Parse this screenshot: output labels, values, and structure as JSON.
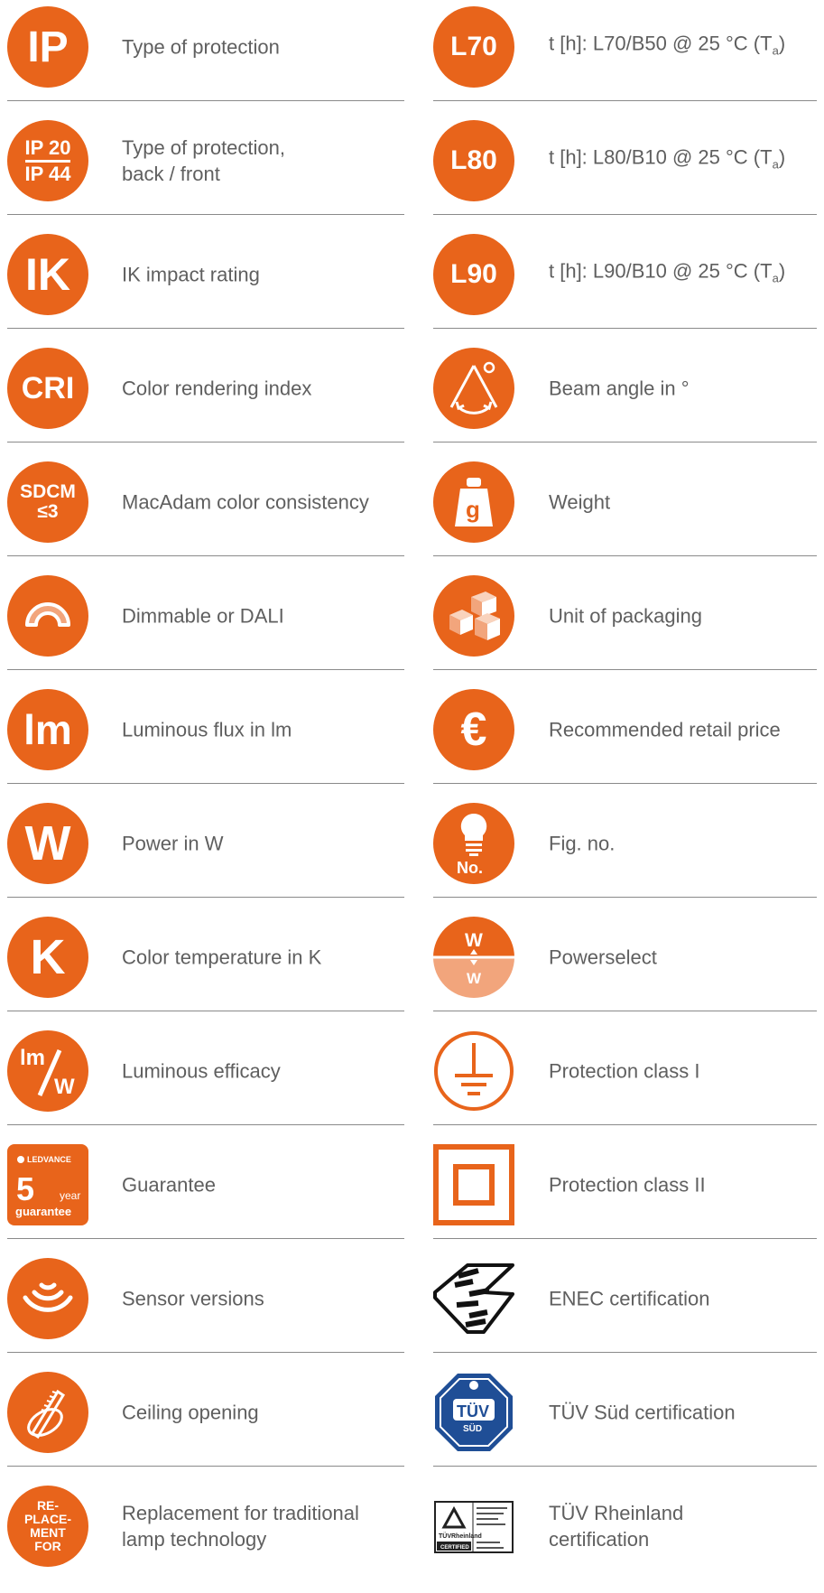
{
  "colors": {
    "accent": "#e8641b",
    "accent_light": "#f2a57c",
    "text": "#5f5f5f",
    "rule": "#8a8a8a"
  },
  "left": [
    {
      "icon": "ip-icon",
      "icon_text": "IP",
      "label": "Type of protection"
    },
    {
      "icon": "ip20-ip44-icon",
      "icon_text_top": "IP 20",
      "icon_text_bottom": "IP 44",
      "label": "Type of protection,\nback / front"
    },
    {
      "icon": "ik-icon",
      "icon_text": "IK",
      "label": "IK impact rating"
    },
    {
      "icon": "cri-icon",
      "icon_text": "CRI",
      "label": "Color rendering index"
    },
    {
      "icon": "sdcm-icon",
      "icon_text_top": "SDCM",
      "icon_text_bottom": "≤3",
      "label": "MacAdam color consistency"
    },
    {
      "icon": "dimmable-icon",
      "label": "Dimmable or DALI"
    },
    {
      "icon": "lm-icon",
      "icon_text": "lm",
      "label": "Luminous flux in lm"
    },
    {
      "icon": "watt-icon",
      "icon_text": "W",
      "label": "Power in W"
    },
    {
      "icon": "kelvin-icon",
      "icon_text": "K",
      "label": "Color temperature in K"
    },
    {
      "icon": "lm-per-w-icon",
      "icon_text_top": "lm",
      "icon_text_bottom": "W",
      "label": "Luminous efficacy"
    },
    {
      "icon": "guarantee-icon",
      "brand": "LEDVANCE",
      "number": "5",
      "unit": "year",
      "word": "guarantee",
      "label": "Guarantee"
    },
    {
      "icon": "sensor-icon",
      "label": "Sensor versions"
    },
    {
      "icon": "ceiling-opening-icon",
      "label": "Ceiling opening"
    },
    {
      "icon": "replacement-icon",
      "icon_lines": [
        "RE-",
        "PLACE-",
        "MENT",
        "FOR"
      ],
      "label": "Replacement for traditional\nlamp technology"
    }
  ],
  "right": [
    {
      "icon": "l70-icon",
      "icon_text": "L70",
      "label": "t [h]: L70/B50 @ 25 °C (T",
      "sub": "a",
      "close": ")"
    },
    {
      "icon": "l80-icon",
      "icon_text": "L80",
      "label": "t [h]: L80/B10 @ 25 °C (T",
      "sub": "a",
      "close": ")"
    },
    {
      "icon": "l90-icon",
      "icon_text": "L90",
      "label": "t [h]: L90/B10 @ 25 °C (T",
      "sub": "a",
      "close": ")"
    },
    {
      "icon": "beam-angle-icon",
      "label": "Beam angle in °"
    },
    {
      "icon": "weight-icon",
      "icon_text": "g",
      "label": "Weight"
    },
    {
      "icon": "packaging-icon",
      "label": "Unit of packaging"
    },
    {
      "icon": "euro-icon",
      "icon_text": "€",
      "label": "Recommended retail price"
    },
    {
      "icon": "lamp-figure-icon",
      "icon_text": "No.",
      "label": "Fig. no."
    },
    {
      "icon": "powerselect-icon",
      "icon_text_top": "W",
      "icon_text_bottom": "W",
      "label": "Powerselect"
    },
    {
      "icon": "protection-class-1-icon",
      "label": "Protection class I"
    },
    {
      "icon": "protection-class-2-icon",
      "label": "Protection class II"
    },
    {
      "icon": "enec-icon",
      "label": "ENEC certification"
    },
    {
      "icon": "tuv-sud-icon",
      "badge_text": "TÜV",
      "badge_sub": "SÜD",
      "label": "TÜV Süd certification"
    },
    {
      "icon": "tuv-rheinland-icon",
      "badge_text": "TÜVRheinland",
      "badge_sub": "CERTIFIED",
      "label": "TÜV Rheinland\ncertification"
    }
  ]
}
